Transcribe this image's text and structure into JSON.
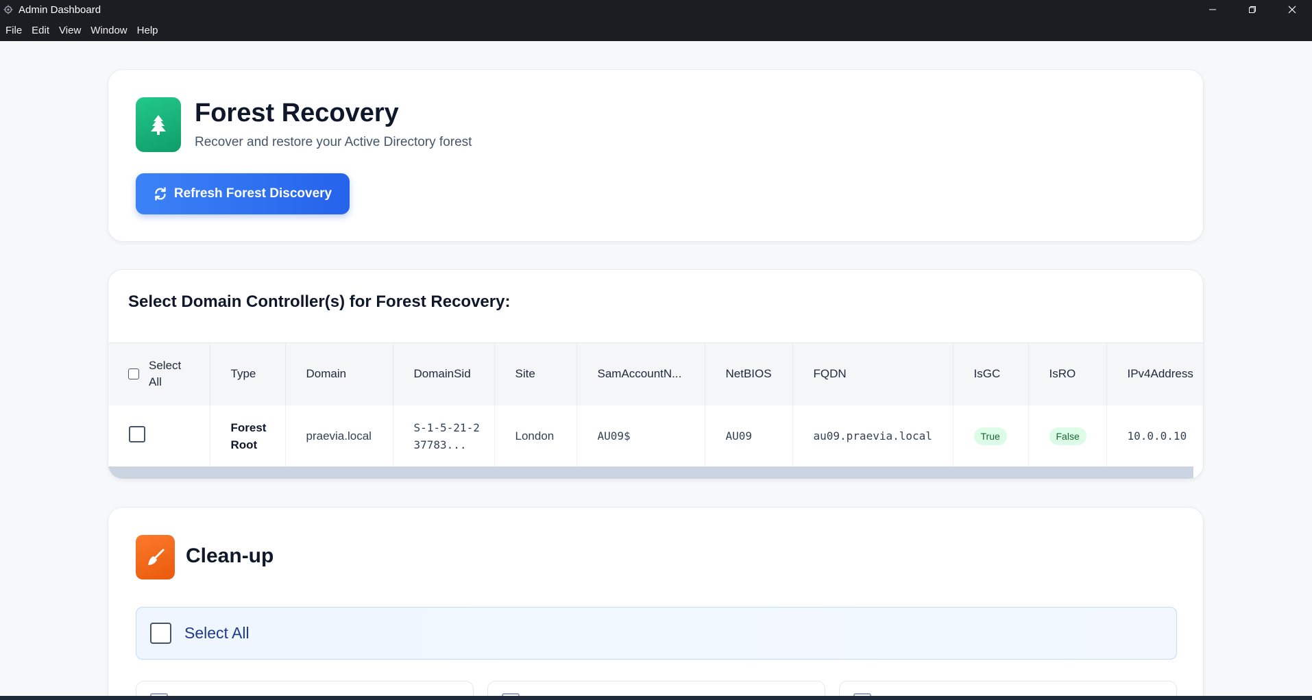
{
  "window": {
    "title": "Admin Dashboard",
    "controls": {
      "minimize": "—",
      "maximize": "❐",
      "close": "✕"
    }
  },
  "menu": [
    "File",
    "Edit",
    "View",
    "Window",
    "Help"
  ],
  "header": {
    "icon": "tree-icon",
    "title": "Forest Recovery",
    "subtitle": "Recover and restore your Active Directory forest",
    "refresh_button": "Refresh Forest Discovery",
    "accent": "#10b981",
    "button_color": "#2563eb"
  },
  "dc_section": {
    "title": "Select Domain Controller(s) for Forest Recovery:",
    "select_all_label": "Select All",
    "columns": [
      "Type",
      "Domain",
      "DomainSid",
      "Site",
      "SamAccountN...",
      "NetBIOS",
      "FQDN",
      "IsGC",
      "IsRO",
      "IPv4Address"
    ],
    "rows": [
      {
        "type": "Forest Root",
        "domain": "praevia.local",
        "domain_sid": "S-1-5-21-237783...",
        "site": "London",
        "sam_account": "AU09$",
        "netbios": "AU09",
        "fqdn": "au09.praevia.local",
        "is_gc": "True",
        "is_ro": "False",
        "ipv4": "10.0.0.10"
      }
    ]
  },
  "cleanup": {
    "icon": "broom-icon",
    "title": "Clean-up",
    "select_all_label": "Select All",
    "accent": "#f97316"
  }
}
